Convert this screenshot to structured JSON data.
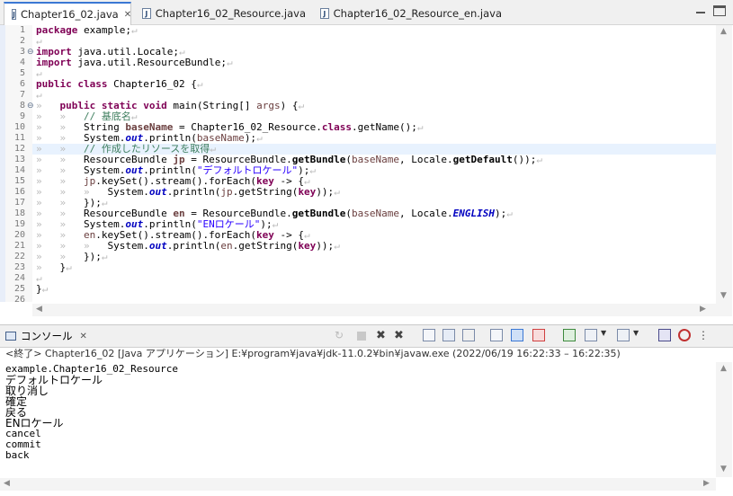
{
  "tabs": [
    {
      "label": "Chapter16_02.java",
      "active": true
    },
    {
      "label": "Chapter16_02_Resource.java",
      "active": false
    },
    {
      "label": "Chapter16_02_Resource_en.java",
      "active": false
    }
  ],
  "tab_close_symbol": "✕",
  "line_numbers": [
    "1",
    "2",
    "3",
    "4",
    "5",
    "6",
    "7",
    "8",
    "9",
    "10",
    "11",
    "12",
    "13",
    "14",
    "15",
    "16",
    "17",
    "18",
    "19",
    "20",
    "21",
    "22",
    "23",
    "24",
    "25",
    "26"
  ],
  "code": {
    "l1": {
      "kw": "package",
      "rest": " example;"
    },
    "l3": {
      "kw": "import",
      "rest": " java.util.Locale;"
    },
    "l4": {
      "kw": "import",
      "rest": " java.util.ResourceBundle;"
    },
    "l6": {
      "kw1": "public",
      "kw2": "class",
      "rest": " Chapter16_02 {"
    },
    "l8": {
      "kw1": "public",
      "kw2": "static",
      "kw3": "void",
      "mid": " main(String[] ",
      "var": "args",
      "rest": ") {"
    },
    "l9": {
      "comment": "// 基底名"
    },
    "l10": {
      "a": "String ",
      "var": "baseName",
      "b": " = Chapter16_02_Resource.",
      "kw": "class",
      "c": ".getName();"
    },
    "l11": {
      "a": "System.",
      "fld": "out",
      "b": ".println(",
      "var": "baseName",
      "c": ");"
    },
    "l12": {
      "comment": "// 作成したリソースを取得"
    },
    "l13": {
      "a": "ResourceBundle ",
      "var": "jp",
      "b": " = ResourceBundle.",
      "m1": "getBundle",
      "c": "(",
      "var2": "baseName",
      "d": ", Locale.",
      "m2": "getDefault",
      "e": "());"
    },
    "l14": {
      "a": "System.",
      "fld": "out",
      "b": ".println(",
      "str": "\"デフォルトロケール\"",
      "c": ");"
    },
    "l15": {
      "var": "jp",
      "a": ".keySet().stream().forEach(",
      "kw": "key",
      "b": " -> {"
    },
    "l16": {
      "a": "System.",
      "fld": "out",
      "b": ".println(",
      "var": "jp",
      "c": ".getString(",
      "kw": "key",
      "d": "));"
    },
    "l17": {
      "a": "});"
    },
    "l18": {
      "a": "ResourceBundle ",
      "var": "en",
      "b": " = ResourceBundle.",
      "m1": "getBundle",
      "c": "(",
      "var2": "baseName",
      "d": ", Locale.",
      "fld": "ENGLISH",
      "e": ");"
    },
    "l19": {
      "a": "System.",
      "fld": "out",
      "b": ".println(",
      "str": "\"ENロケール\"",
      "c": ");"
    },
    "l20": {
      "var": "en",
      "a": ".keySet().stream().forEach(",
      "kw": "key",
      "b": " -> {"
    },
    "l21": {
      "a": "System.",
      "fld": "out",
      "b": ".println(",
      "var": "en",
      "c": ".getString(",
      "kw": "key",
      "d": "));"
    },
    "l22": {
      "a": "});"
    },
    "l23": {
      "a": "}"
    },
    "l25": {
      "a": "}"
    }
  },
  "console": {
    "tab_label": "コンソール",
    "header": "<終了> Chapter16_02 [Java アプリケーション] E:¥program¥java¥jdk-11.0.2¥bin¥javaw.exe  (2022/06/19 16:22:33 – 16:22:35)",
    "output": [
      "example.Chapter16_02_Resource",
      "デフォルトロケール",
      "取り消し",
      "確定",
      "戻る",
      "ENロケール",
      "cancel",
      "commit",
      "back"
    ]
  }
}
